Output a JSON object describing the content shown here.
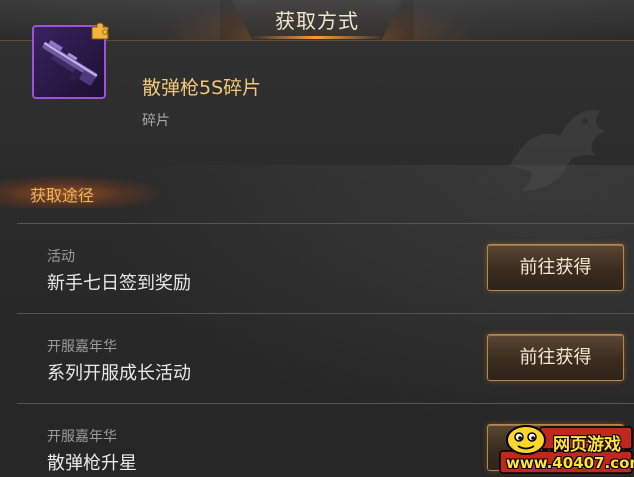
{
  "header": {
    "title": "获取方式"
  },
  "item": {
    "name": "散弹枪5S碎片",
    "type": "碎片",
    "icon": "shotgun-icon",
    "badge_icon": "puzzle-piece-icon",
    "rarity_color": "#9a54d6"
  },
  "section": {
    "label": "获取途径"
  },
  "sources": [
    {
      "category": "活动",
      "name": "新手七日签到奖励",
      "button": "前往获得"
    },
    {
      "category": "开服嘉年华",
      "name": "系列开服成长活动",
      "button": "前往获得"
    },
    {
      "category": "开服嘉年华",
      "name": "散弹枪升星",
      "button": "前往获得"
    }
  ],
  "watermark": {
    "line1": "网页游戏",
    "line2": "www.40407.com"
  },
  "colors": {
    "accent": "#ff9a30",
    "item_name": "#f1c87a",
    "section_label": "#f0b45e"
  }
}
